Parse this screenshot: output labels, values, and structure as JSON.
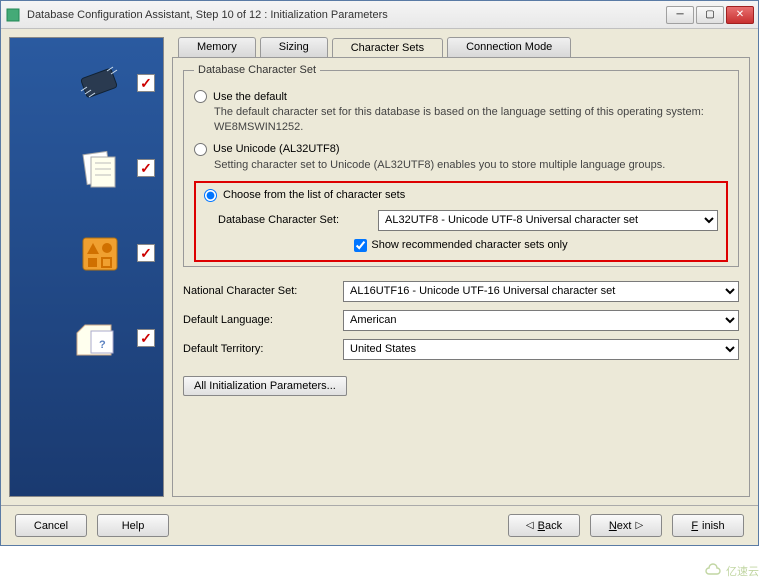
{
  "window": {
    "title": "Database Configuration Assistant, Step 10 of 12 : Initialization Parameters"
  },
  "tabs": {
    "memory": "Memory",
    "sizing": "Sizing",
    "charsets": "Character Sets",
    "connmode": "Connection Mode"
  },
  "fieldset_legend": "Database Character Set",
  "opt_default": {
    "label": "Use the default",
    "desc": "The default character set for this database is based on the language setting of this operating system: WE8MSWIN1252."
  },
  "opt_unicode": {
    "label": "Use Unicode (AL32UTF8)",
    "desc": "Setting character set to Unicode (AL32UTF8) enables you to store multiple language groups."
  },
  "opt_choose": {
    "label": "Choose from the list of character sets",
    "db_charset_label": "Database Character Set:",
    "db_charset_value": "AL32UTF8 - Unicode UTF-8 Universal character set",
    "show_recommended": "Show recommended character sets only"
  },
  "national": {
    "label": "National Character Set:",
    "value": "AL16UTF16 - Unicode UTF-16 Universal character set"
  },
  "language": {
    "label": "Default Language:",
    "value": "American"
  },
  "territory": {
    "label": "Default Territory:",
    "value": "United States"
  },
  "all_params_btn": "All Initialization Parameters...",
  "footer": {
    "cancel": "Cancel",
    "help": "Help",
    "back": "Back",
    "next": "Next",
    "finish": "Finish"
  },
  "watermark": "亿速云"
}
